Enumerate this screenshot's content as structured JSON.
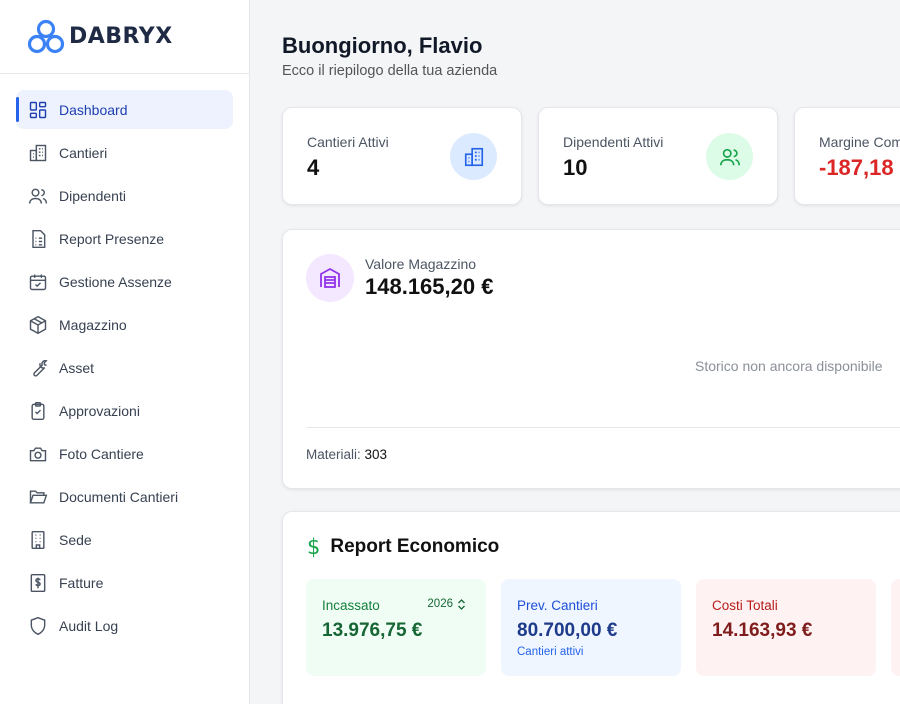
{
  "brand": {
    "name": "DABRYX"
  },
  "sidebar": {
    "items": [
      {
        "label": "Dashboard",
        "icon": "dashboard-icon",
        "active": true
      },
      {
        "label": "Cantieri",
        "icon": "building-icon"
      },
      {
        "label": "Dipendenti",
        "icon": "users-icon"
      },
      {
        "label": "Report Presenze",
        "icon": "report-icon"
      },
      {
        "label": "Gestione Assenze",
        "icon": "calendar-check-icon"
      },
      {
        "label": "Magazzino",
        "icon": "package-icon"
      },
      {
        "label": "Asset",
        "icon": "wrench-icon"
      },
      {
        "label": "Approvazioni",
        "icon": "clipboard-check-icon"
      },
      {
        "label": "Foto Cantiere",
        "icon": "camera-icon"
      },
      {
        "label": "Documenti Cantieri",
        "icon": "folder-open-icon"
      },
      {
        "label": "Sede",
        "icon": "office-building-icon"
      },
      {
        "label": "Fatture",
        "icon": "invoice-icon"
      },
      {
        "label": "Audit Log",
        "icon": "shield-icon"
      }
    ]
  },
  "header": {
    "greeting": "Buongiorno, Flavio",
    "subtitle": "Ecco il riepilogo della tua azienda"
  },
  "kpis": [
    {
      "label": "Cantieri Attivi",
      "value": "4",
      "icon": "building-icon",
      "color": "#2563eb",
      "bg": "#dbeafe"
    },
    {
      "label": "Dipendenti Attivi",
      "value": "10",
      "icon": "users-icon",
      "color": "#16a34a",
      "bg": "#dcfce7"
    },
    {
      "label": "Margine Com",
      "value": "-187,18",
      "icon": "",
      "color": "#dc2626",
      "bg": ""
    }
  ],
  "warehouse": {
    "label": "Valore Magazzino",
    "value": "148.165,20 €",
    "empty_text": "Storico non ancora disponibile",
    "materials_label": "Materiali:",
    "materials_value": "303",
    "icon": "warehouse-icon",
    "color": "#9333ea"
  },
  "economic_report": {
    "title": "Report Economico",
    "icon": "dollar-icon",
    "tiles": [
      {
        "label": "Incassato",
        "value": "13.976,75 €",
        "year": "2026",
        "bg": "#f0fdf4",
        "color": "#166534"
      },
      {
        "label": "Prev. Cantieri",
        "value": "80.700,00 €",
        "note": "Cantieri attivi",
        "bg": "#eff6ff",
        "color": "#1e3a8a"
      },
      {
        "label": "Costi Totali",
        "value": "14.163,93 €",
        "bg": "#fef2f2",
        "color": "#7f1d1d"
      }
    ]
  }
}
